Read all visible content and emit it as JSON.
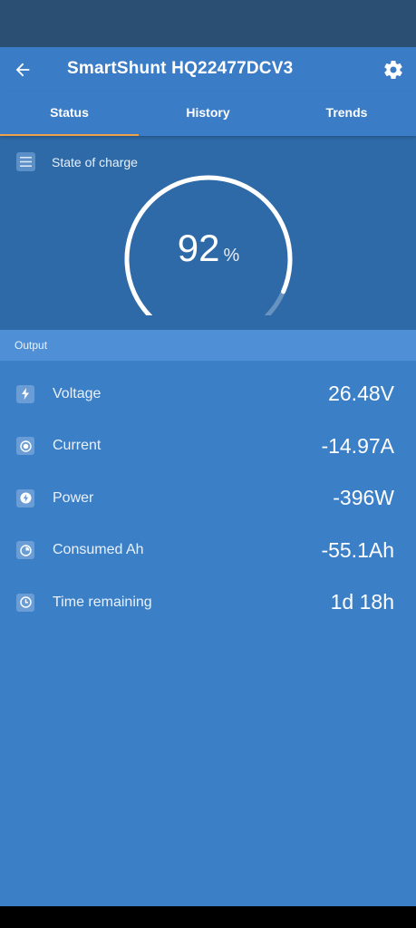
{
  "app": {
    "title": "SmartShunt HQ22477DCV3"
  },
  "icons": {
    "back": "arrow-left-icon",
    "settings": "gear-icon"
  },
  "tabs": [
    {
      "label": "Status",
      "active": true
    },
    {
      "label": "History",
      "active": false
    },
    {
      "label": "Trends",
      "active": false
    }
  ],
  "soc": {
    "label": "State of charge",
    "value": "92",
    "unit": "%",
    "percent": 92
  },
  "output": {
    "section_label": "Output",
    "rows": [
      {
        "label": "Voltage",
        "value": "26.48V",
        "icon": "bolt-icon"
      },
      {
        "label": "Current",
        "value": "-14.97A",
        "icon": "current-icon"
      },
      {
        "label": "Power",
        "value": "-396W",
        "icon": "power-icon"
      },
      {
        "label": "Consumed Ah",
        "value": "-55.1Ah",
        "icon": "consumed-icon"
      },
      {
        "label": "Time remaining",
        "value": "1d 18h",
        "icon": "clock-icon"
      }
    ]
  },
  "colors": {
    "accent": "#f0a24a",
    "background": "#3b7fc7",
    "panel": "#2e6aa8"
  }
}
